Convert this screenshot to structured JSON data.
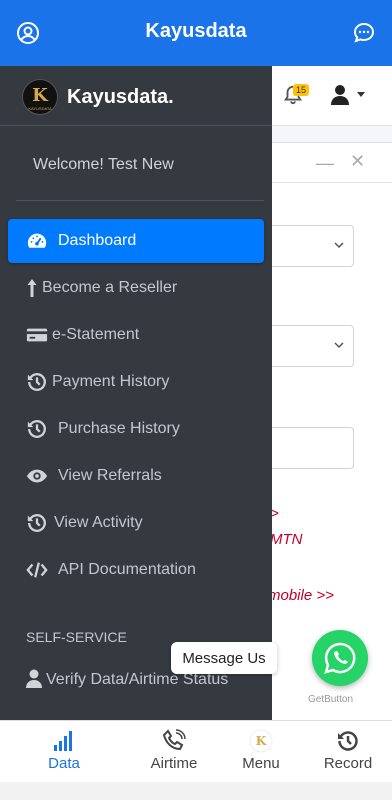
{
  "app_bar": {
    "title": "Kayusdata",
    "left_icon": "account-circle-icon",
    "right_icon": "chat-bubble-icon"
  },
  "topnav": {
    "notification_count": "15"
  },
  "drawer": {
    "brand_name": "Kayusdata.",
    "logo_letter": "K",
    "logo_subtext": "KAYUSDATA",
    "welcome": "Welcome! Test New",
    "items": [
      {
        "label": "Dashboard",
        "icon": "tachometer-icon",
        "active": true
      },
      {
        "label": "Become a Reseller",
        "icon": "arrow-up-icon"
      },
      {
        "label": "e-Statement",
        "icon": "credit-card-icon"
      },
      {
        "label": "Payment History",
        "icon": "history-icon"
      },
      {
        "label": "Purchase History",
        "icon": "history-icon"
      },
      {
        "label": "View Referrals",
        "icon": "eye-icon"
      },
      {
        "label": "View Activity",
        "icon": "history-icon"
      },
      {
        "label": "API Documentation",
        "icon": "code-icon"
      }
    ],
    "section_header": "SELF-SERVICE",
    "section_items": [
      {
        "label": "Verify Data/Airtime Status",
        "icon": "user-icon"
      }
    ]
  },
  "page": {
    "red_lines": [
      ">",
      "MTN",
      "mobile >>"
    ]
  },
  "whatsapp": {
    "bubble": "Message Us",
    "credit": "GetButton"
  },
  "bottom_nav": [
    {
      "label": "Data",
      "icon": "signal-bars-icon",
      "active": true
    },
    {
      "label": "Airtime",
      "icon": "phone-ringing-icon"
    },
    {
      "label": "Menu",
      "icon": "kayusdata-logo-icon"
    },
    {
      "label": "Record",
      "icon": "history-icon"
    }
  ],
  "colors": {
    "primary": "#1a73e8",
    "drawer_bg": "#343a40",
    "active_item": "#007bff",
    "whatsapp": "#25d366",
    "badge": "#ffc107"
  }
}
